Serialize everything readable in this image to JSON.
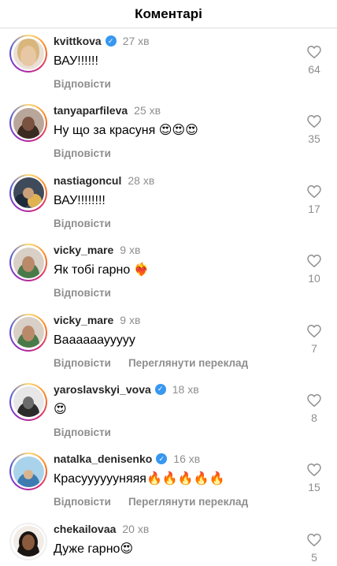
{
  "header": {
    "title": "Коментарі"
  },
  "actions": {
    "reply": "Відповісти",
    "translate": "Переглянути переклад"
  },
  "comments": [
    {
      "username": "kvittkova",
      "verified": true,
      "time": "27 хв",
      "text": "ВАУ!!!!!!",
      "likes": "64",
      "translate": false
    },
    {
      "username": "tanyaparfileva",
      "verified": false,
      "time": "25 хв",
      "text": "Ну що за красуня 😍😍😍",
      "likes": "35",
      "translate": false
    },
    {
      "username": "nastiagoncul",
      "verified": false,
      "time": "28 хв",
      "text": "ВАУ!!!!!!!!",
      "likes": "17",
      "translate": false
    },
    {
      "username": "vicky_mare",
      "verified": false,
      "time": "9 хв",
      "text": "Як тобі гарно ❤️‍🔥",
      "likes": "10",
      "translate": false
    },
    {
      "username": "vicky_mare",
      "verified": false,
      "time": "9 хв",
      "text": "Вааааааууууу",
      "likes": "7",
      "translate": true
    },
    {
      "username": "yaroslavskyi_vova",
      "verified": true,
      "time": "18 хв",
      "text": "😍",
      "likes": "8",
      "translate": false
    },
    {
      "username": "natalka_denisenko",
      "verified": true,
      "time": "16 хв",
      "text": "Красууууууняяя🔥🔥🔥🔥🔥",
      "likes": "15",
      "translate": true
    },
    {
      "username": "chekailovaa",
      "verified": false,
      "time": "20 хв",
      "text": "Дуже гарно😍",
      "likes": "5",
      "translate": false
    }
  ],
  "colors": {
    "secondary_text": "#8e8e8e",
    "verified_blue": "#3897f0",
    "divider": "#dbdbdb"
  },
  "icons": {
    "like": "heart-outline-icon",
    "verified": "verified-badge-icon"
  }
}
